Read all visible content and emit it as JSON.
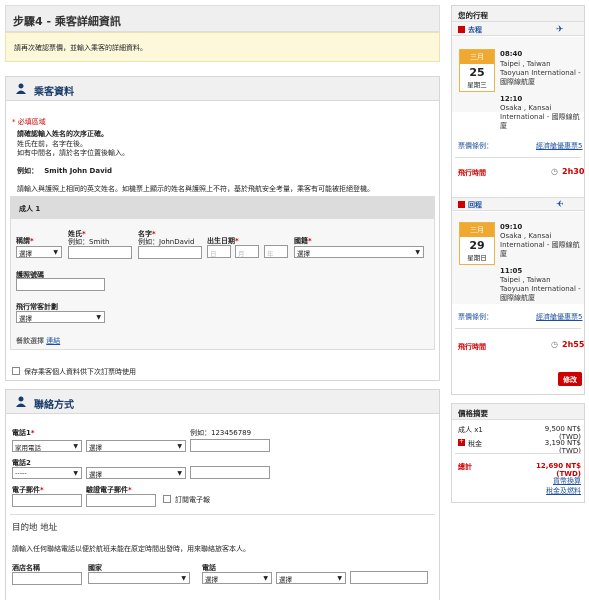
{
  "step": {
    "title": "步驟4 - 乘客詳細資訊"
  },
  "notice": {
    "text": "請再次確認票價，並輸入乘客的詳細資料。"
  },
  "passenger": {
    "title": "乘客資料",
    "required": "* 必填區域",
    "name_order_title": "請確認輸入姓名的次序正確。",
    "name_order_l1": "姓氏在前，名字在後。",
    "name_order_l2": "如有中間名，請於名字位置後輸入。",
    "example_label": "例如：",
    "example_value": "Smith John David",
    "passport_note": "請輸入與護照上相同的英文姓名。如機票上顯示的姓名與護照上不符，基於飛航安全考量，乘客有可能被拒絕登機。",
    "adult_label": "成人 1",
    "title_label": "稱謂",
    "title_value": "選擇",
    "surname_label": "姓氏",
    "surname_hint": "例如：Smith",
    "given_label": "名字",
    "given_hint": "例如：JohnDavid",
    "dob_label": "出生日期",
    "dob_day": "日",
    "dob_month": "月",
    "dob_year": "年",
    "nationality_label": "國籍",
    "nationality_value": "選擇",
    "passport_label": "護照號碼",
    "ffp_label": "飛行常客計劃",
    "ffp_value": "選擇",
    "meal_label": "餐飲選擇",
    "meal_link": "連結",
    "save_label": "保存乘客個人資料供下次訂票時使用"
  },
  "contact": {
    "title": "聯絡方式",
    "phone1_label": "電話1",
    "phone1_example": "例如：123456789",
    "phone1_type": "家用電話",
    "phone1_code": "選擇",
    "phone2_label": "電話2",
    "phone2_type": "-----",
    "phone2_code": "選擇",
    "email_label": "電子郵件",
    "email_confirm_label": "驗證電子郵件",
    "newsletter_label": "訂閱電子報",
    "dest_title": "目的地 地址",
    "dest_note": "請輸入任何聯絡電話以便於航班未能在原定時間出發時，用來聯絡旅客本人。",
    "hotel_label": "酒店名稱",
    "country_label": "國家",
    "phone_label": "電話",
    "phone_code": "選擇",
    "phone_type": "選擇"
  },
  "itinerary": {
    "title": "您的行程",
    "outbound": {
      "label": "去程",
      "month": "三月",
      "day": "25",
      "weekday": "星期三",
      "dep_time": "08:40",
      "dep_place": "Taipei , Taiwan",
      "dep_airport": "Taoyuan International - 國際線航廈",
      "arr_time": "12:10",
      "arr_place": "Osaka , Kansai",
      "arr_airport": "International - 國際線航廈",
      "fare_label": "票價條例：",
      "fare_link": "經濟艙優惠票5",
      "duration_label": "飛行時間",
      "duration": "2h30"
    },
    "inbound": {
      "label": "回程",
      "month": "三月",
      "day": "29",
      "weekday": "星期日",
      "dep_time": "09:10",
      "dep_place": "Osaka , Kansai",
      "dep_airport": "International - 國際線航廈",
      "arr_time": "11:05",
      "arr_place": "Taipei , Taiwan",
      "arr_airport": "Taoyuan International - 國際線航廈",
      "fare_label": "票價條例：",
      "fare_link": "經濟艙優惠票5",
      "duration_label": "飛行時間",
      "duration": "2h55"
    },
    "modify": "修改"
  },
  "price": {
    "title": "價格摘要",
    "adult_label": "成人 x1",
    "adult_value": "9,500 NT$ (TWD)",
    "tax_label": "稅金",
    "tax_value": "3,190 NT$ (TWD)",
    "total_label": "總計",
    "total_value": "12,690 NT$ (TWD)",
    "link1": "貨幣換算",
    "link2": "稅金及燃料"
  },
  "colors": {
    "accent": "#c00000",
    "link": "#1b4f9c",
    "date": "#f0a830"
  }
}
